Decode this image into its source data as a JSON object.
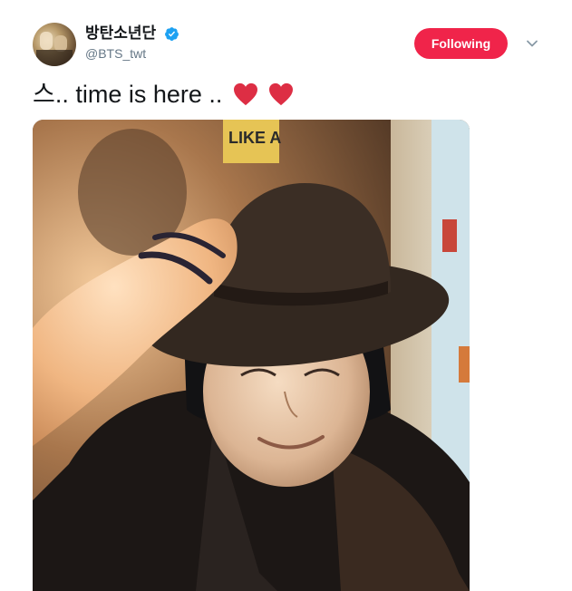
{
  "user": {
    "display_name": "방탄소년단",
    "handle": "@BTS_twt",
    "verified_icon": "verified-badge-icon",
    "avatar_icon": "profile-avatar"
  },
  "follow_button": {
    "label": "Following",
    "color": "#f0244a"
  },
  "caret": {
    "icon": "chevron-down-icon"
  },
  "tweet": {
    "text": "스.. time is here ..",
    "emoji": [
      "heart-icon",
      "heart-icon"
    ],
    "heart_color": "#dd2e44"
  },
  "media": {
    "kind": "photo",
    "poster_sign": "LIKE A"
  },
  "colors": {
    "accent": "#1da1f2",
    "text": "#14171a",
    "muted": "#657786"
  }
}
